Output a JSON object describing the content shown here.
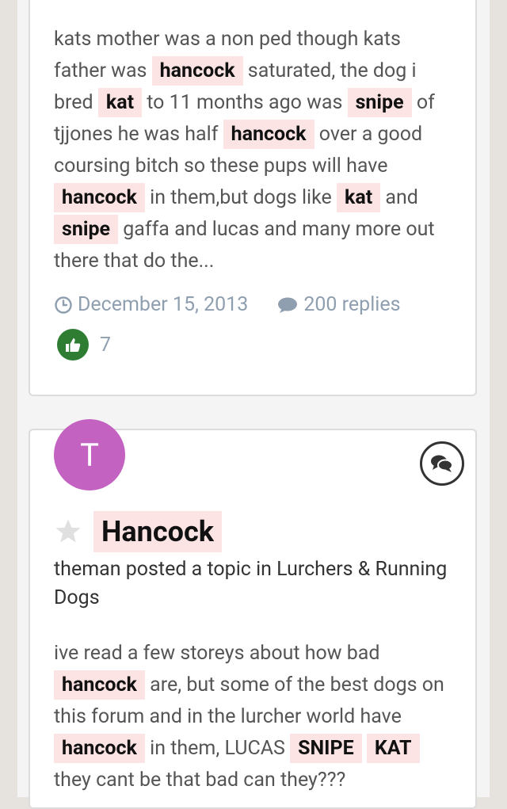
{
  "result1": {
    "snippet": [
      {
        "t": "kats mother was a non ped though kats father was "
      },
      {
        "h": "hancock"
      },
      {
        "t": " saturated, the dog i bred "
      },
      {
        "h": "kat"
      },
      {
        "t": " to 11 months ago was "
      },
      {
        "h": "snipe"
      },
      {
        "t": " of tjjones he was half "
      },
      {
        "h": "hancock"
      },
      {
        "t": " over a good coursing bitch so these pups will have "
      },
      {
        "h": "hancock"
      },
      {
        "t": " in them,but dogs like "
      },
      {
        "h": "kat"
      },
      {
        "t": " and "
      },
      {
        "h": "snipe"
      },
      {
        "t": " gaffa and lucas and many more out there that do the..."
      }
    ],
    "date": "December 15, 2013",
    "replies": "200 replies",
    "likes": "7"
  },
  "result2": {
    "avatar_letter": "T",
    "title": "Hancock",
    "posted_line": "theman posted a topic in Lurchers & Running Dogs",
    "snippet": [
      {
        "t": "ive read a few storeys about how bad "
      },
      {
        "h": "hancock"
      },
      {
        "t": " are, but some of the best dogs on this forum and in the lurcher world have "
      },
      {
        "h": "hancock"
      },
      {
        "t": " in them, LUCAS "
      },
      {
        "h": "SNIPE"
      },
      {
        "t": " "
      },
      {
        "h": "KAT"
      },
      {
        "t": " they cant be that bad can they???"
      }
    ]
  },
  "colors": {
    "highlight_bg": "#fde4e4",
    "avatar_bg": "#c362c1",
    "meta_text": "#8f9fb0",
    "like_green": "#2e7d32"
  }
}
